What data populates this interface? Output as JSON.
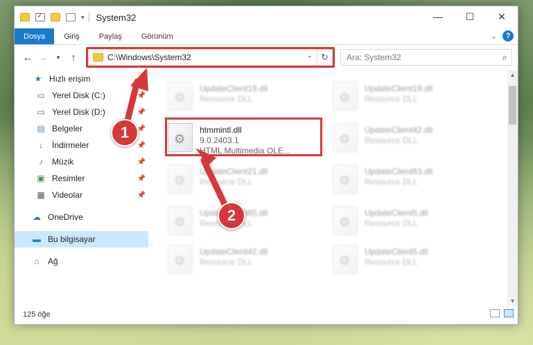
{
  "window": {
    "title": "System32",
    "controls": {
      "minimize": "—",
      "maximize": "☐",
      "close": "✕"
    }
  },
  "ribbon": {
    "tabs": [
      "Dosya",
      "Giriş",
      "Paylaş",
      "Görünüm"
    ],
    "help_label": "?"
  },
  "nav": {
    "address": "C:\\Windows\\System32",
    "search_placeholder": "Ara: System32"
  },
  "sidebar": {
    "items": [
      {
        "label": "Hızlı erişim",
        "icon": "star-icon",
        "pinned": false
      },
      {
        "label": "Yerel Disk (C:)",
        "icon": "drive-icon",
        "pinned": true
      },
      {
        "label": "Yerel Disk (D:)",
        "icon": "drive-icon",
        "pinned": true
      },
      {
        "label": "Belgeler",
        "icon": "documents-icon",
        "pinned": true
      },
      {
        "label": "İndirmeler",
        "icon": "download-icon",
        "pinned": true
      },
      {
        "label": "Müzik",
        "icon": "music-icon",
        "pinned": true
      },
      {
        "label": "Resimler",
        "icon": "pictures-icon",
        "pinned": true
      },
      {
        "label": "Videolar",
        "icon": "video-icon",
        "pinned": true
      },
      {
        "label": "OneDrive",
        "icon": "cloud-icon",
        "pinned": false
      },
      {
        "label": "Bu bilgisayar",
        "icon": "computer-icon",
        "pinned": false
      },
      {
        "label": "Ağ",
        "icon": "network-icon",
        "pinned": false
      }
    ]
  },
  "files": {
    "focused": {
      "name": "htmmintl.dll",
      "version": "9.0.2403.1",
      "description": "HTML Multimedia OLE..."
    },
    "blurred": [
      {
        "name": "UpdateClient19.dll",
        "type": "Resource DLL"
      },
      {
        "name": "UpdateClient19.dll",
        "type": "Resource DLL"
      },
      {
        "name": "UpdateClient42.dll",
        "type": "Resource DLL"
      },
      {
        "name": "UpdateClient21.dll",
        "type": "Resource DLL"
      },
      {
        "name": "UpdateClient63.dll",
        "type": "Resource DLL"
      },
      {
        "name": "UpdateClient65.dll",
        "type": "Resource DLL"
      },
      {
        "name": "UpdateClient5.dll",
        "type": "Resource DLL"
      },
      {
        "name": "UpdateClient42.dll",
        "type": "Resource DLL"
      },
      {
        "name": "UpdateClient5.dll",
        "type": "Resource DLL"
      }
    ]
  },
  "status": {
    "count": "125 öğe"
  },
  "annotations": {
    "step1": "1",
    "step2": "2"
  },
  "colors": {
    "accent": "#1979ca",
    "highlight": "#d8373a",
    "selected": "#cce8ff"
  }
}
